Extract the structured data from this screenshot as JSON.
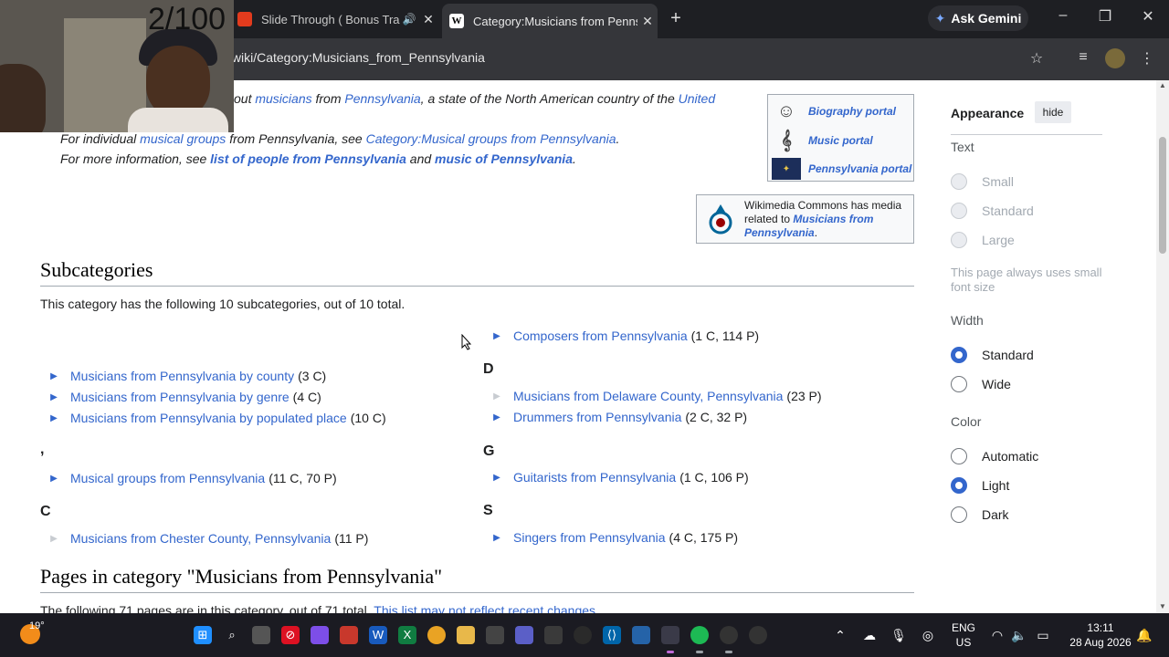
{
  "browser": {
    "tabs": [
      {
        "title": "Slide Through ( Bonus Track",
        "active": false
      },
      {
        "title": "Category:Musicians from Penns",
        "active": true
      }
    ],
    "new_tab": "+",
    "gemini_label": "Ask Gemini",
    "url": "/wiki/Category:Musicians_from_Pennsylvania",
    "window": {
      "minimize": "–",
      "maximize": "❐",
      "close": "✕"
    }
  },
  "overlay": {
    "counter": "2/100"
  },
  "page": {
    "hatnote1": {
      "pre": "out ",
      "l1": "musicians",
      "mid1": " from ",
      "l2": "Pennsylvania",
      "mid2": ", a state of the North American country of the ",
      "l3": "United"
    },
    "hatnote2": {
      "pre": "For individual ",
      "l1": "musical groups",
      "mid": " from Pennsylvania, see ",
      "l2": "Category:Musical groups from Pennsylvania",
      "post": "."
    },
    "hatnote3": {
      "pre": "For more information, see ",
      "l1": "list of people from Pennsylvania",
      "mid": " and ",
      "l2": "music of Pennsylvania",
      "post": "."
    },
    "portals": [
      "Biography portal",
      "Music portal",
      "Pennsylvania portal"
    ],
    "commons": {
      "pre": "Wikimedia Commons has media related to ",
      "link": "Musicians from Pennsylvania",
      "post": "."
    },
    "subcat_heading": "Subcategories",
    "subcat_intro": "This category has the following 10 subcategories, out of 10 total.",
    "left_col": {
      "group1": [
        {
          "label": "Musicians from Pennsylvania by county",
          "count": "(3 C)"
        },
        {
          "label": "Musicians from Pennsylvania by genre",
          "count": "(4 C)"
        },
        {
          "label": "Musicians from Pennsylvania by populated place",
          "count": "(10 C)"
        }
      ],
      "letter_comma": ",",
      "group2": [
        {
          "label": "Musical groups from Pennsylvania",
          "count": "(11 C, 70 P)"
        }
      ],
      "letter_c": "C",
      "group3": [
        {
          "label": "Musicians from Chester County, Pennsylvania",
          "count": "(11 P)"
        }
      ]
    },
    "right_col": {
      "top": [
        {
          "label": "Composers from Pennsylvania",
          "count": "(1 C, 114 P)"
        }
      ],
      "letter_d": "D",
      "d_items": [
        {
          "label": "Musicians from Delaware County, Pennsylvania",
          "count": "(23 P)"
        },
        {
          "label": "Drummers from Pennsylvania",
          "count": "(2 C, 32 P)"
        }
      ],
      "letter_g": "G",
      "g_items": [
        {
          "label": "Guitarists from Pennsylvania",
          "count": "(1 C, 106 P)"
        }
      ],
      "letter_s": "S",
      "s_items": [
        {
          "label": "Singers from Pennsylvania",
          "count": "(4 C, 175 P)"
        }
      ]
    },
    "pages_heading": "Pages in category \"Musicians from Pennsylvania\"",
    "pages_intro": {
      "pre": "The following 71 pages are in this category, out of 71 total. ",
      "link": "This list may not reflect recent changes"
    }
  },
  "appearance": {
    "title": "Appearance",
    "hide": "hide",
    "text_label": "Text",
    "text_options": [
      "Small",
      "Standard",
      "Large"
    ],
    "text_note": "This page always uses small font size",
    "width_label": "Width",
    "width_options": [
      "Standard",
      "Wide"
    ],
    "width_selected": "Standard",
    "color_label": "Color",
    "color_options": [
      "Automatic",
      "Light",
      "Dark"
    ],
    "color_selected": "Light"
  },
  "taskbar": {
    "temperature": "19°",
    "lang": "ENG",
    "region": "US",
    "time": "13:11",
    "date": "28 Aug 2026"
  },
  "colors": {
    "link": "#3366cc",
    "accent": "#3366cc",
    "chrome": "#35363a",
    "taskbar": "#1b1b22"
  }
}
